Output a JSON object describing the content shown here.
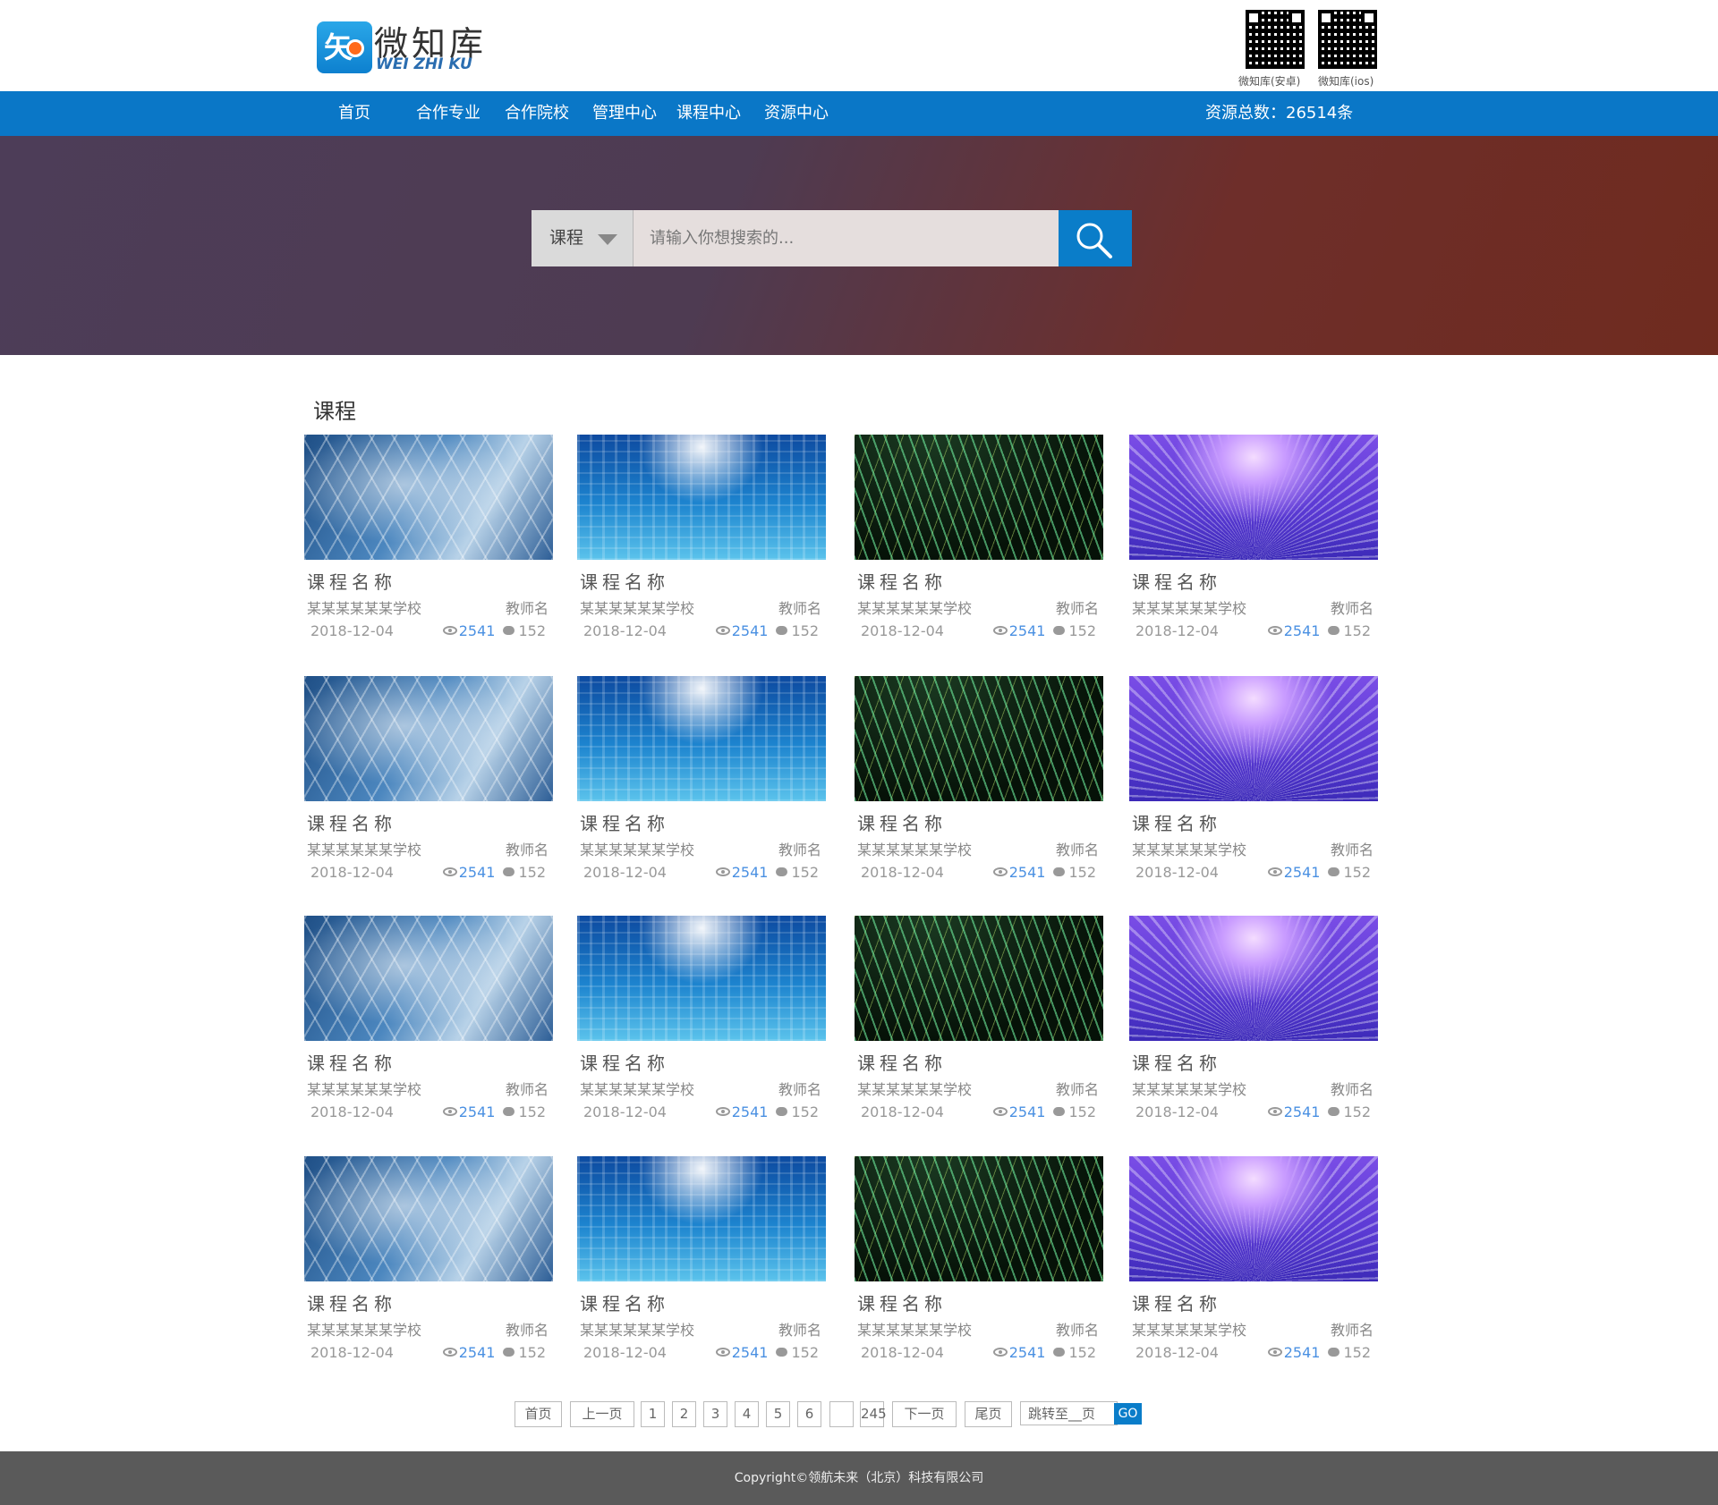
{
  "brand": {
    "logo_glyph": "矢",
    "name_cn": "微知库",
    "name_en": "WEI ZHI KU",
    "qr_android_label": "微知库(安卓)",
    "qr_ios_label": "微知库(ios)"
  },
  "nav": {
    "items": [
      "首页",
      "合作专业",
      "合作院校",
      "管理中心",
      "课程中心",
      "资源中心"
    ],
    "resource_count": "资源总数：26514条",
    "background": "#0a77c7"
  },
  "search": {
    "category": "课程",
    "placeholder": "请输入你想搜索的..."
  },
  "section": {
    "title": "课程"
  },
  "courses": [
    {
      "thumb": "blue-hex",
      "name": "课程名称",
      "school": "某某某某某某学校",
      "teacher": "教师名",
      "date": "2018-12-04",
      "views": "2541",
      "comments": "152"
    },
    {
      "thumb": "cyan-city",
      "name": "课程名称",
      "school": "某某某某某某学校",
      "teacher": "教师名",
      "date": "2018-12-04",
      "views": "2541",
      "comments": "152"
    },
    {
      "thumb": "green-lines",
      "name": "课程名称",
      "school": "某某某某某某学校",
      "teacher": "教师名",
      "date": "2018-12-04",
      "views": "2541",
      "comments": "152"
    },
    {
      "thumb": "purple-fan",
      "name": "课程名称",
      "school": "某某某某某某学校",
      "teacher": "教师名",
      "date": "2018-12-04",
      "views": "2541",
      "comments": "152"
    },
    {
      "thumb": "blue-hex",
      "name": "课程名称",
      "school": "某某某某某某学校",
      "teacher": "教师名",
      "date": "2018-12-04",
      "views": "2541",
      "comments": "152"
    },
    {
      "thumb": "cyan-city",
      "name": "课程名称",
      "school": "某某某某某某学校",
      "teacher": "教师名",
      "date": "2018-12-04",
      "views": "2541",
      "comments": "152"
    },
    {
      "thumb": "green-lines",
      "name": "课程名称",
      "school": "某某某某某某学校",
      "teacher": "教师名",
      "date": "2018-12-04",
      "views": "2541",
      "comments": "152"
    },
    {
      "thumb": "purple-fan",
      "name": "课程名称",
      "school": "某某某某某某学校",
      "teacher": "教师名",
      "date": "2018-12-04",
      "views": "2541",
      "comments": "152"
    },
    {
      "thumb": "blue-hex",
      "name": "课程名称",
      "school": "某某某某某某学校",
      "teacher": "教师名",
      "date": "2018-12-04",
      "views": "2541",
      "comments": "152"
    },
    {
      "thumb": "cyan-city",
      "name": "课程名称",
      "school": "某某某某某某学校",
      "teacher": "教师名",
      "date": "2018-12-04",
      "views": "2541",
      "comments": "152"
    },
    {
      "thumb": "green-lines",
      "name": "课程名称",
      "school": "某某某某某某学校",
      "teacher": "教师名",
      "date": "2018-12-04",
      "views": "2541",
      "comments": "152"
    },
    {
      "thumb": "purple-fan",
      "name": "课程名称",
      "school": "某某某某某某学校",
      "teacher": "教师名",
      "date": "2018-12-04",
      "views": "2541",
      "comments": "152"
    },
    {
      "thumb": "blue-hex",
      "name": "课程名称",
      "school": "某某某某某某学校",
      "teacher": "教师名",
      "date": "2018-12-04",
      "views": "2541",
      "comments": "152"
    },
    {
      "thumb": "cyan-city",
      "name": "课程名称",
      "school": "某某某某某某学校",
      "teacher": "教师名",
      "date": "2018-12-04",
      "views": "2541",
      "comments": "152"
    },
    {
      "thumb": "green-lines",
      "name": "课程名称",
      "school": "某某某某某某学校",
      "teacher": "教师名",
      "date": "2018-12-04",
      "views": "2541",
      "comments": "152"
    },
    {
      "thumb": "purple-fan",
      "name": "课程名称",
      "school": "某某某某某某学校",
      "teacher": "教师名",
      "date": "2018-12-04",
      "views": "2541",
      "comments": "152"
    }
  ],
  "pagination": {
    "first": "首页",
    "prev": "上一页",
    "pages": [
      "1",
      "2",
      "3",
      "4",
      "5",
      "6",
      "",
      "245"
    ],
    "next": "下一页",
    "last": "尾页",
    "jump": "跳转至__页",
    "go": "GO"
  },
  "footer": {
    "copyright": "Copyright©领航未来（北京）科技有限公司"
  }
}
